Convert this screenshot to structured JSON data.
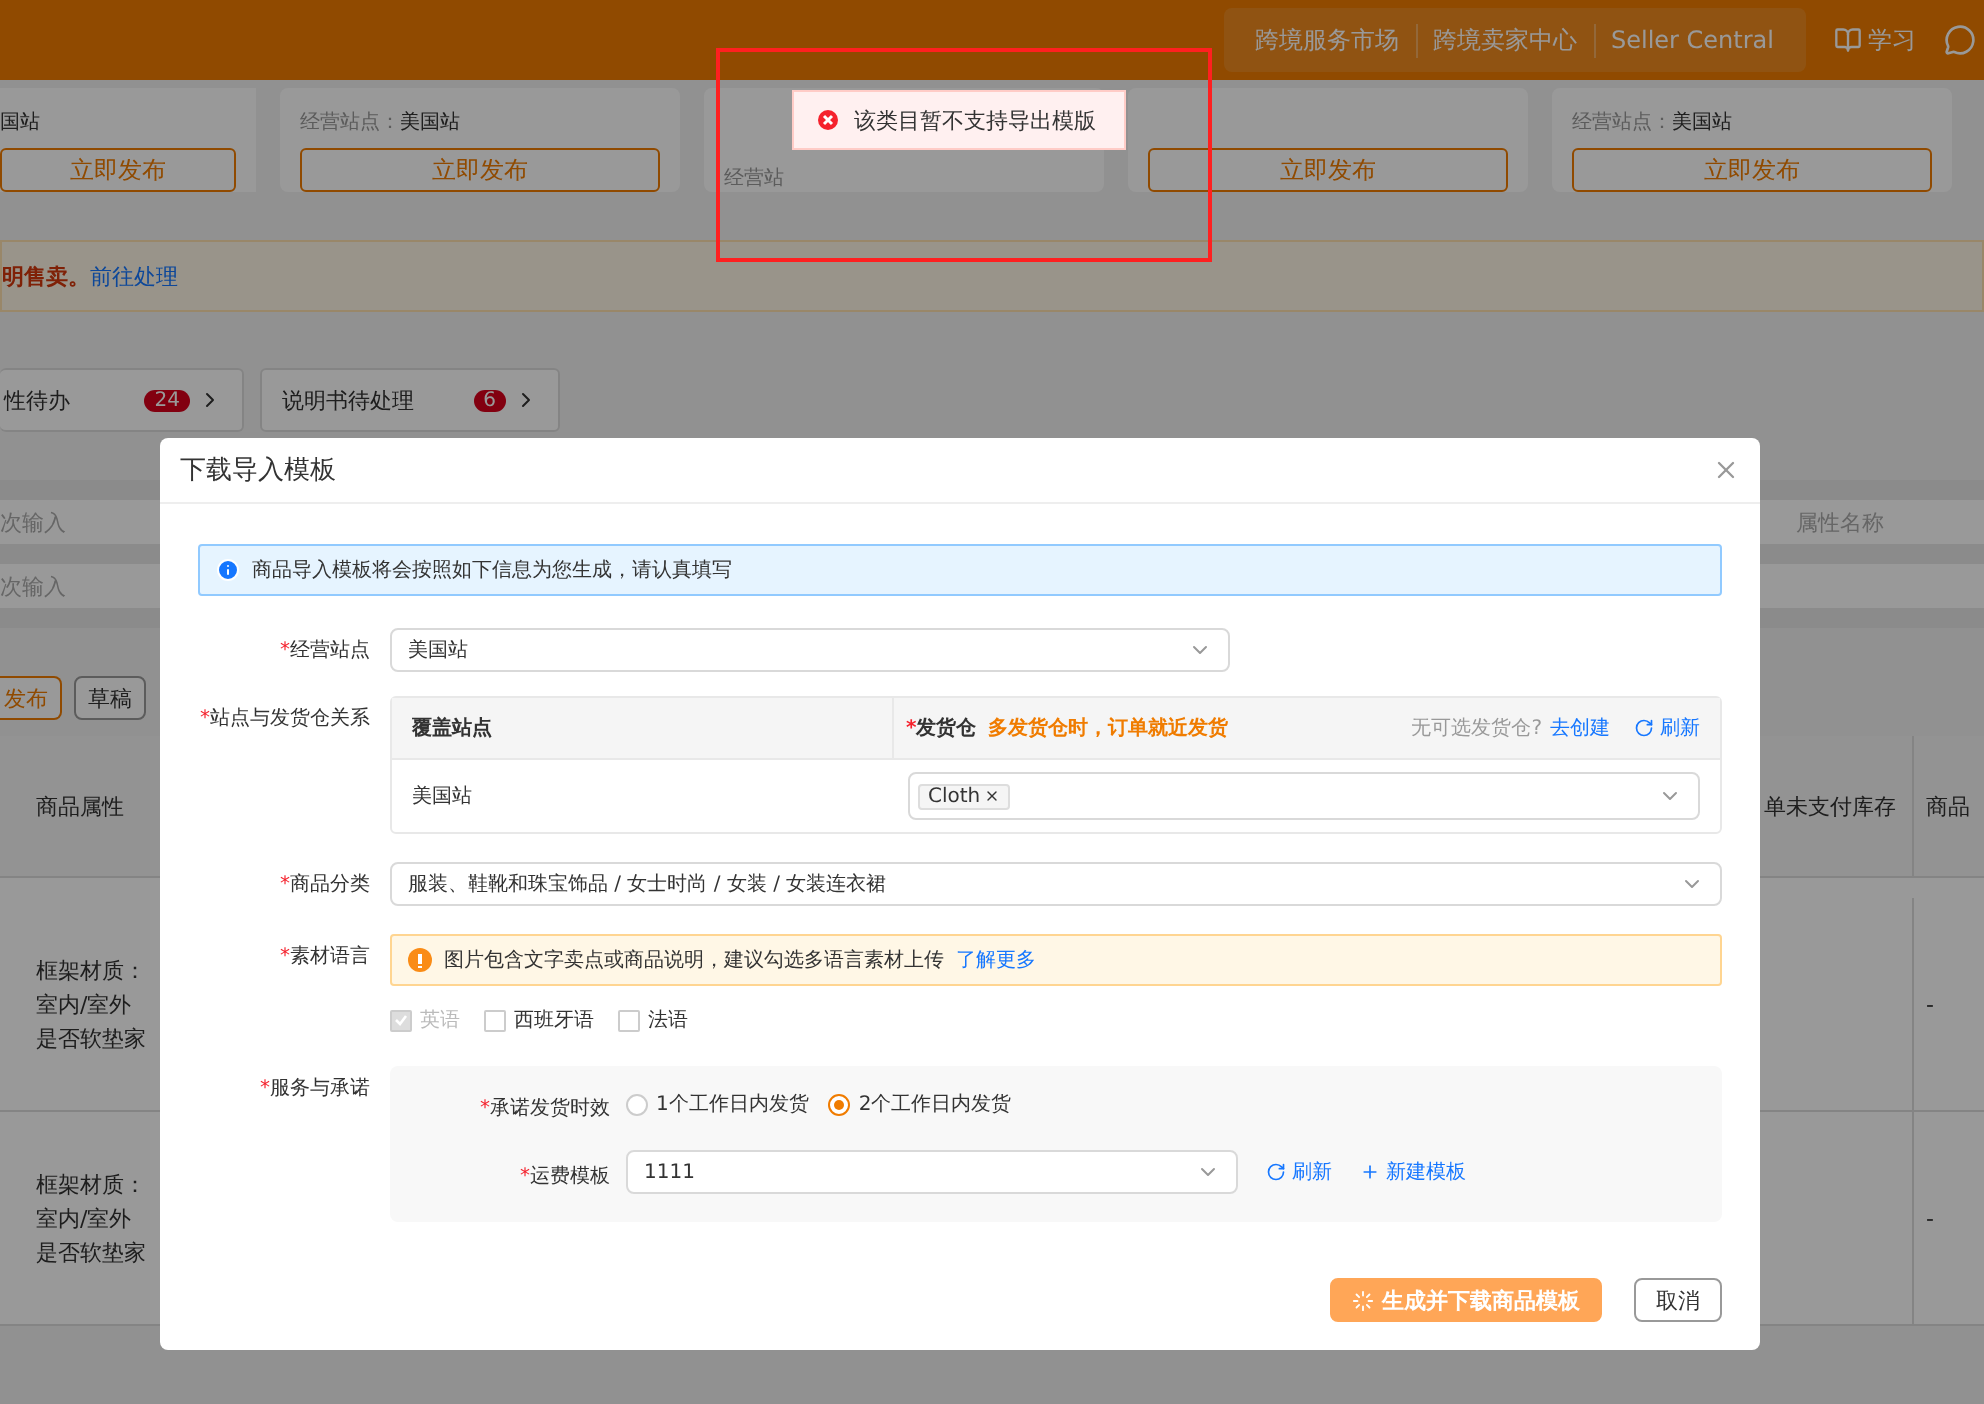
{
  "header": {
    "nav_links": [
      "跨境服务市场",
      "跨境卖家中心",
      "Seller Central"
    ],
    "learn_label": "学习"
  },
  "cards": [
    {
      "site_value": "国站",
      "button": "立即发布"
    },
    {
      "site_label": "经营站点：",
      "site_value": "美国站",
      "button": "立即发布"
    },
    {
      "site_label": "经营站"
    },
    {
      "button": "立即发布"
    },
    {
      "site_label": "经营站点：",
      "site_value": "美国站",
      "button": "立即发布"
    }
  ],
  "notice": {
    "text": "明售卖。",
    "link": "前往处理"
  },
  "todo_tabs": [
    {
      "label": "性待办",
      "count": "24"
    },
    {
      "label": "说明书待处理",
      "count": "6"
    }
  ],
  "filters": [
    {
      "left": "次输入",
      "right": "属性名称"
    },
    {
      "left": "次输入"
    }
  ],
  "actions": [
    {
      "label": "发布",
      "kind": "primary"
    },
    {
      "label": "草稿",
      "kind": "default"
    }
  ],
  "table": {
    "columns": [
      "商品属性",
      "单未支付库存",
      "商品"
    ],
    "rows": [
      {
        "attributes": [
          "框架材质：",
          "室内/室外",
          "是否软垫家"
        ],
        "code": "-"
      },
      {
        "attributes": [
          "框架材质：",
          "室内/室外",
          "是否软垫家"
        ],
        "code": "-"
      }
    ]
  },
  "modal": {
    "title": "下载导入模板",
    "info": "商品导入模板将会按照如下信息为您生成，请认真填写",
    "site": {
      "required_mark": "*",
      "label": "经营站点",
      "value": "美国站"
    },
    "relation": {
      "required_mark": "*",
      "label": "站点与发货仓关系",
      "col_site": "覆盖站点",
      "col_warehouse": "发货仓",
      "hint": "多发货仓时，订单就近发货",
      "no_warehouse": "无可选发货仓?",
      "create_link": "去创建",
      "refresh": "刷新",
      "rows": [
        {
          "site": "美国站",
          "tags": [
            "Cloth"
          ]
        }
      ]
    },
    "category": {
      "required_mark": "*",
      "label": "商品分类",
      "value": "服装、鞋靴和珠宝饰品 / 女士时尚 / 女装 / 女装连衣裙"
    },
    "language": {
      "required_mark": "*",
      "label": "素材语言",
      "warning": "图片包含文字卖点或商品说明，建议勾选多语言素材上传",
      "link": "了解更多",
      "options": [
        {
          "label": "英语",
          "checked": true,
          "disabled": true
        },
        {
          "label": "西班牙语",
          "checked": false,
          "disabled": false
        },
        {
          "label": "法语",
          "checked": false,
          "disabled": false
        }
      ]
    },
    "service": {
      "required_mark": "*",
      "label": "服务与承诺",
      "shipping": {
        "required_mark": "*",
        "label": "承诺发货时效",
        "options": [
          {
            "label": "1个工作日内发货",
            "selected": false
          },
          {
            "label": "2个工作日内发货",
            "selected": true
          }
        ]
      },
      "freight": {
        "required_mark": "*",
        "label": "运费模板",
        "value": "1111",
        "refresh": "刷新",
        "create": "新建模板"
      }
    },
    "buttons": [
      {
        "label": "生成并下载商品模板",
        "kind": "primary",
        "loading": true
      },
      {
        "label": "取消",
        "kind": "default",
        "loading": false
      }
    ]
  },
  "toast": {
    "message": "该类目暂不支持导出模版",
    "kind": "error"
  }
}
